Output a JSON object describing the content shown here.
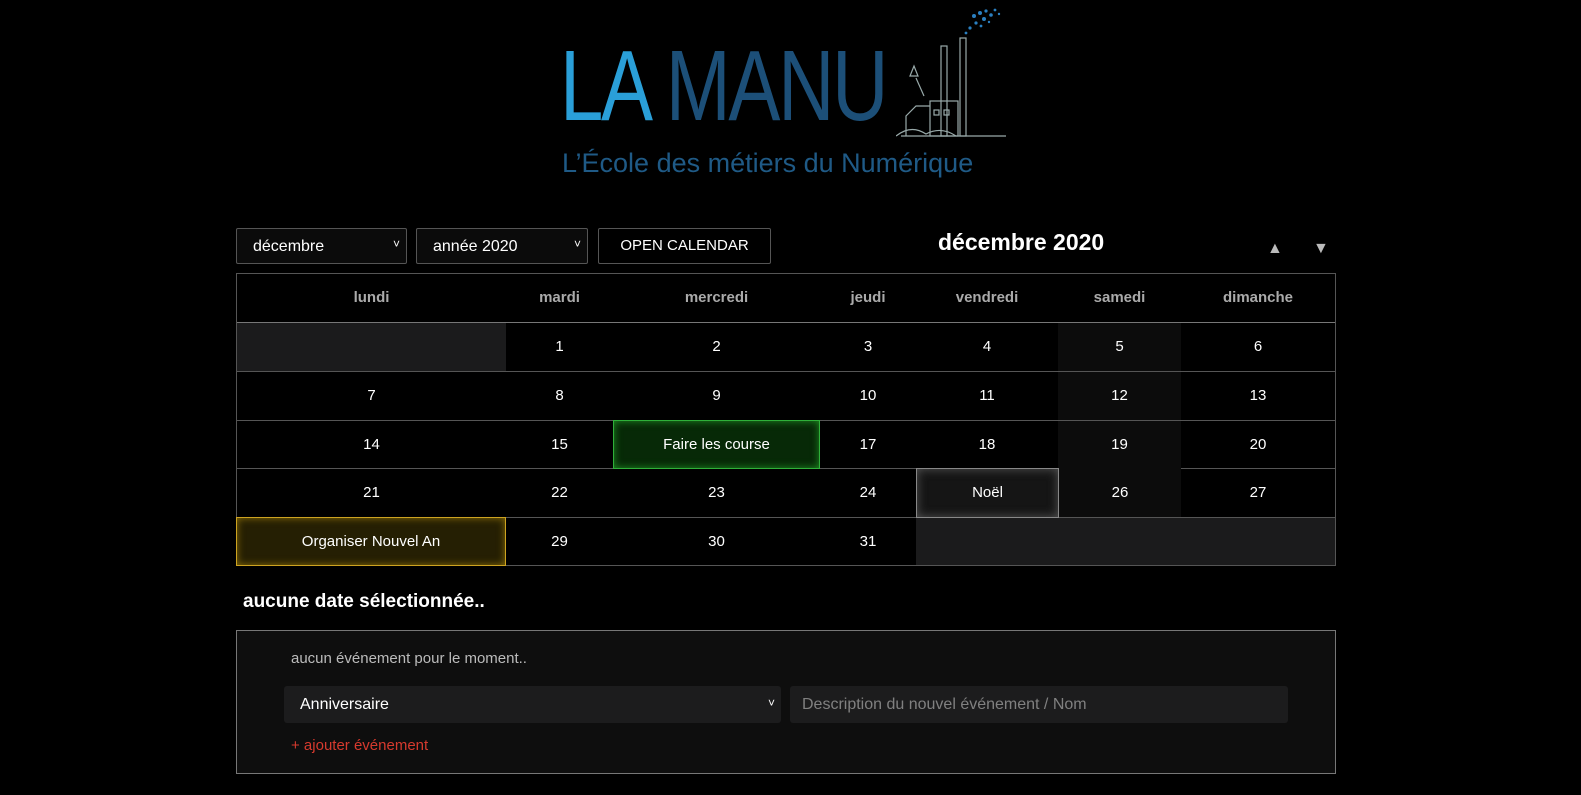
{
  "logo": {
    "main_left": "LA ",
    "main_right": "MANU",
    "subtitle": "L’École des métiers du Numérique"
  },
  "controls": {
    "month_select": "décembre",
    "year_select": "année 2020",
    "open_button": "OPEN CALENDAR",
    "title": "décembre 2020",
    "prev_arrow": "▲",
    "next_arrow": "▼"
  },
  "calendar": {
    "weekdays": [
      "lundi",
      "mardi",
      "mercredi",
      "jeudi",
      "vendredi",
      "samedi",
      "dimanche"
    ],
    "weeks": [
      [
        "",
        "1",
        "2",
        "3",
        "4",
        "5",
        "6"
      ],
      [
        "7",
        "8",
        "9",
        "10",
        "11",
        "12",
        "13"
      ],
      [
        "14",
        "15",
        "Faire les course",
        "17",
        "18",
        "19",
        "20"
      ],
      [
        "21",
        "22",
        "23",
        "24",
        "Noël",
        "26",
        "27"
      ],
      [
        "Organiser Nouvel An",
        "29",
        "30",
        "31",
        "",
        "",
        ""
      ]
    ]
  },
  "selection": {
    "label": "aucune date sélectionnée.."
  },
  "panel": {
    "no_event": "aucun événement pour le moment..",
    "type_select": "Anniversaire",
    "description_placeholder": "Description du nouvel événement / Nom",
    "add_link": "+ ajouter événement"
  },
  "colors": {
    "accent_green": "#2fb03a",
    "accent_yellow": "#cda321",
    "link_red": "#d63a2e",
    "logo_blue": "#2a9fd8"
  }
}
